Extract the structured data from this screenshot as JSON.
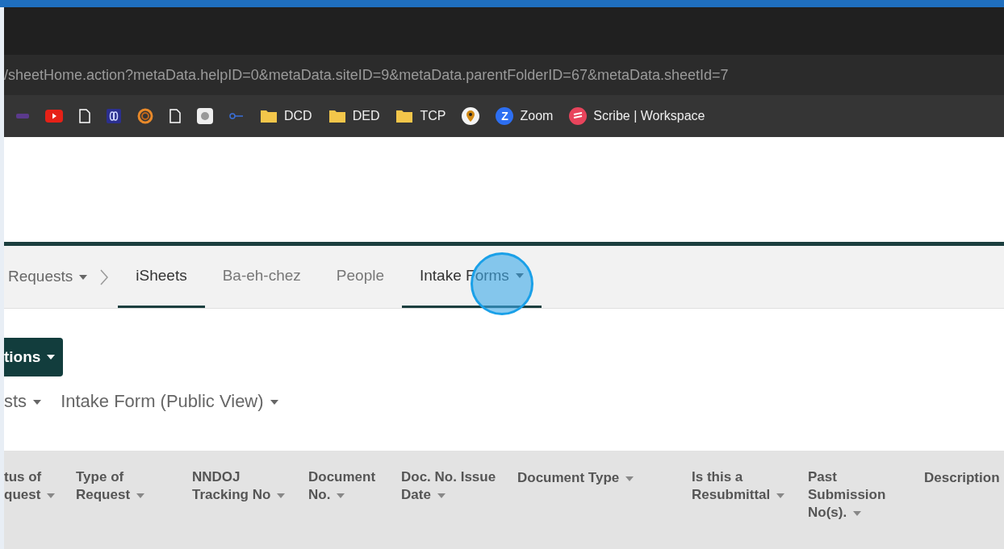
{
  "address_bar": {
    "url": "/sheetHome.action?metaData.helpID=0&metaData.siteID=9&metaData.parentFolderID=67&metaData.sheetId=7"
  },
  "bookmarks": [
    {
      "kind": "purple"
    },
    {
      "kind": "youtube"
    },
    {
      "kind": "page"
    },
    {
      "kind": "bluelogo"
    },
    {
      "kind": "ring"
    },
    {
      "kind": "page"
    },
    {
      "kind": "graylogo"
    },
    {
      "kind": "key"
    },
    {
      "kind": "folder",
      "label": "DCD"
    },
    {
      "kind": "folder",
      "label": "DED"
    },
    {
      "kind": "folder",
      "label": "TCP"
    },
    {
      "kind": "pin"
    },
    {
      "kind": "zoom",
      "glyph": "Z",
      "label": "Zoom"
    },
    {
      "kind": "scribe",
      "label": "Scribe | Workspace"
    }
  ],
  "nav": {
    "breadcrumb": "Requests",
    "tabs": [
      {
        "label": "iSheets",
        "selected": true,
        "dropdown": false
      },
      {
        "label": "Ba-eh-chez",
        "selected": false,
        "dropdown": false
      },
      {
        "label": "People",
        "selected": false,
        "dropdown": false
      },
      {
        "label": "Intake Forms",
        "selected": true,
        "dropdown": true
      }
    ],
    "click_marker": true
  },
  "actions_button": {
    "label": "tions"
  },
  "views": [
    {
      "label": "sts"
    },
    {
      "label": "Intake Form (Public View)"
    }
  ],
  "table": {
    "columns": [
      {
        "lines": [
          "tus of",
          "quest"
        ],
        "sortable": true
      },
      {
        "lines": [
          "Type of",
          "Request"
        ],
        "sortable": true
      },
      {
        "lines": [
          "NNDOJ",
          "Tracking No"
        ],
        "sortable": true
      },
      {
        "lines": [
          "Document",
          "No."
        ],
        "sortable": true
      },
      {
        "lines": [
          "Doc. No. Issue",
          "Date"
        ],
        "sortable": true
      },
      {
        "lines": [
          "Document Type"
        ],
        "sortable": true
      },
      {
        "lines": [
          "Is this a",
          "Resubmittal"
        ],
        "sortable": true
      },
      {
        "lines": [
          "Past",
          "Submission",
          "No(s)."
        ],
        "sortable": true
      },
      {
        "lines": [
          "Description"
        ],
        "sortable": false
      }
    ]
  }
}
